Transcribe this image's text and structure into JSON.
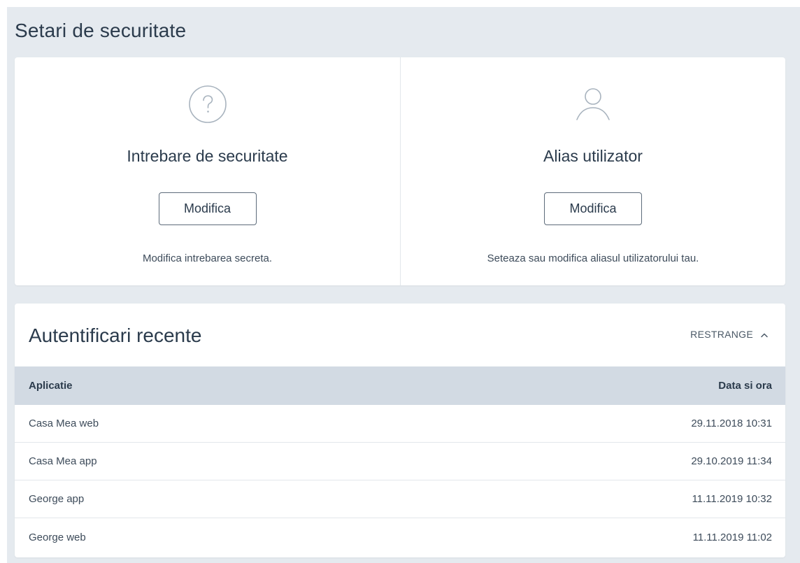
{
  "page": {
    "title": "Setari de securitate"
  },
  "cards": [
    {
      "icon": "question-circle-icon",
      "title": "Intrebare de securitate",
      "button_label": "Modifica",
      "description": "Modifica intrebarea secreta."
    },
    {
      "icon": "user-icon",
      "title": "Alias utilizator",
      "button_label": "Modifica",
      "description": "Seteaza sau modifica aliasul utilizatorului tau."
    }
  ],
  "recent": {
    "title": "Autentificari recente",
    "collapse_label": "RESTRANGE",
    "collapse_icon": "chevron-up-icon",
    "columns": [
      "Aplicatie",
      "Data si ora"
    ],
    "rows": [
      {
        "app": "Casa Mea web",
        "datetime": "29.11.2018 10:31"
      },
      {
        "app": "Casa Mea app",
        "datetime": "29.10.2019 11:34"
      },
      {
        "app": "George app",
        "datetime": "11.11.2019 10:32"
      },
      {
        "app": "George web",
        "datetime": "11.11.2019 11:02"
      }
    ]
  },
  "colors": {
    "page_background": "#e5eaef",
    "card_background": "#ffffff",
    "table_header": "#d2dae3",
    "icon_stroke": "#a8b3be",
    "text": "#2b3b4c"
  }
}
